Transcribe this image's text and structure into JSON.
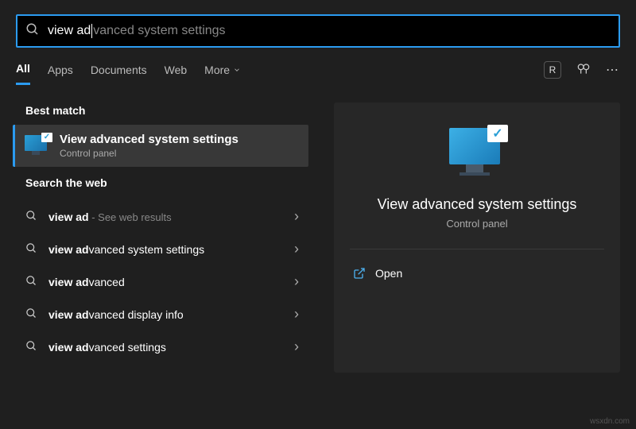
{
  "search": {
    "typed": "view ad",
    "ghost": "vanced system settings"
  },
  "tabs": {
    "items": [
      "All",
      "Apps",
      "Documents",
      "Web",
      "More"
    ],
    "active_index": 0,
    "user_badge": "R"
  },
  "best_match": {
    "section_label": "Best match",
    "title_bold": "View ad",
    "title_rest": "vanced system settings",
    "subtitle": "Control panel"
  },
  "web": {
    "section_label": "Search the web",
    "items": [
      {
        "bold": "view ad",
        "rest": "",
        "hint": " - See web results"
      },
      {
        "bold": "view ad",
        "rest": "vanced system settings",
        "hint": ""
      },
      {
        "bold": "view ad",
        "rest": "vanced",
        "hint": ""
      },
      {
        "bold": "view ad",
        "rest": "vanced display info",
        "hint": ""
      },
      {
        "bold": "view ad",
        "rest": "vanced settings",
        "hint": ""
      }
    ]
  },
  "preview": {
    "title": "View advanced system settings",
    "subtitle": "Control panel",
    "action_open": "Open"
  },
  "watermark": "wsxdn.com"
}
